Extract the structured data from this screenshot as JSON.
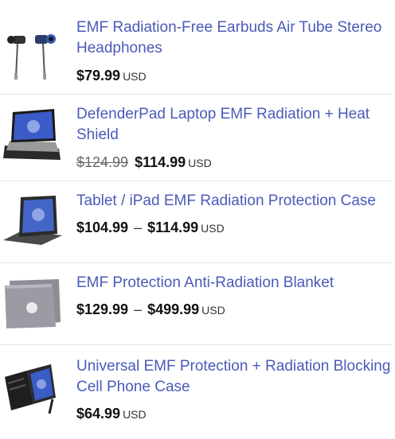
{
  "products": [
    {
      "title": "EMF Radiation-Free Earbuds Air Tube Stereo Headphones",
      "image_icon": "earbuds-image",
      "price": "$79.99",
      "currency": "USD"
    },
    {
      "title": "DefenderPad Laptop EMF Radiation + Heat Shield",
      "image_icon": "laptop-pad-image",
      "old_price": "$124.99",
      "price": "$114.99",
      "currency": "USD"
    },
    {
      "title": "Tablet / iPad EMF Radiation Protection Case",
      "image_icon": "tablet-case-image",
      "price_min": "$104.99",
      "price_sep": "–",
      "price_max": "$114.99",
      "currency": "USD"
    },
    {
      "title": "EMF Protection Anti-Radiation Blanket",
      "image_icon": "blanket-image",
      "price_min": "$129.99",
      "price_sep": "–",
      "price_max": "$499.99",
      "currency": "USD"
    },
    {
      "title": "Universal EMF Protection + Radiation Blocking Cell Phone Case",
      "image_icon": "phone-case-image",
      "price": "$64.99",
      "currency": "USD"
    }
  ]
}
